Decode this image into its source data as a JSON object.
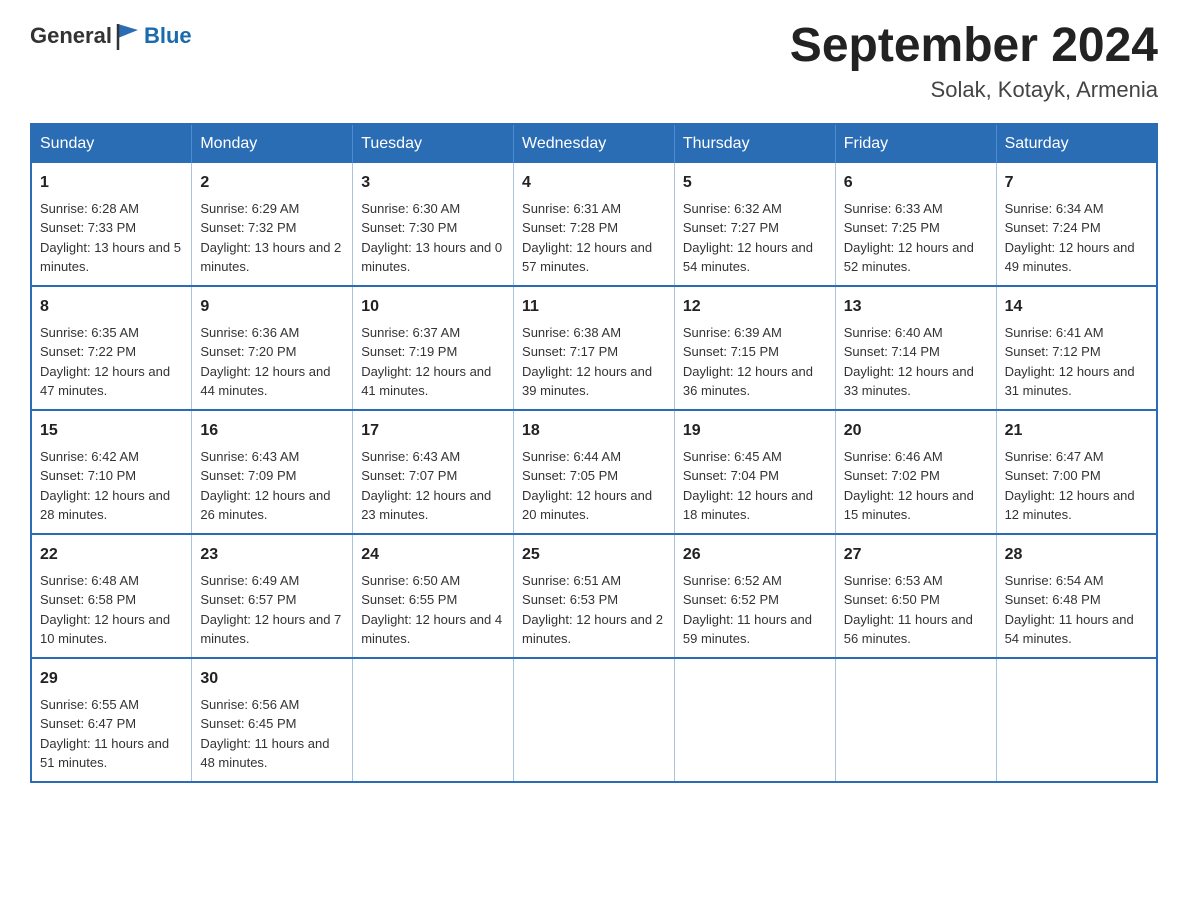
{
  "header": {
    "logo": {
      "text_general": "General",
      "text_blue": "Blue"
    },
    "title": "September 2024",
    "location": "Solak, Kotayk, Armenia"
  },
  "calendar": {
    "days_of_week": [
      "Sunday",
      "Monday",
      "Tuesday",
      "Wednesday",
      "Thursday",
      "Friday",
      "Saturday"
    ],
    "weeks": [
      [
        {
          "day": "1",
          "sunrise": "6:28 AM",
          "sunset": "7:33 PM",
          "daylight": "13 hours and 5 minutes."
        },
        {
          "day": "2",
          "sunrise": "6:29 AM",
          "sunset": "7:32 PM",
          "daylight": "13 hours and 2 minutes."
        },
        {
          "day": "3",
          "sunrise": "6:30 AM",
          "sunset": "7:30 PM",
          "daylight": "13 hours and 0 minutes."
        },
        {
          "day": "4",
          "sunrise": "6:31 AM",
          "sunset": "7:28 PM",
          "daylight": "12 hours and 57 minutes."
        },
        {
          "day": "5",
          "sunrise": "6:32 AM",
          "sunset": "7:27 PM",
          "daylight": "12 hours and 54 minutes."
        },
        {
          "day": "6",
          "sunrise": "6:33 AM",
          "sunset": "7:25 PM",
          "daylight": "12 hours and 52 minutes."
        },
        {
          "day": "7",
          "sunrise": "6:34 AM",
          "sunset": "7:24 PM",
          "daylight": "12 hours and 49 minutes."
        }
      ],
      [
        {
          "day": "8",
          "sunrise": "6:35 AM",
          "sunset": "7:22 PM",
          "daylight": "12 hours and 47 minutes."
        },
        {
          "day": "9",
          "sunrise": "6:36 AM",
          "sunset": "7:20 PM",
          "daylight": "12 hours and 44 minutes."
        },
        {
          "day": "10",
          "sunrise": "6:37 AM",
          "sunset": "7:19 PM",
          "daylight": "12 hours and 41 minutes."
        },
        {
          "day": "11",
          "sunrise": "6:38 AM",
          "sunset": "7:17 PM",
          "daylight": "12 hours and 39 minutes."
        },
        {
          "day": "12",
          "sunrise": "6:39 AM",
          "sunset": "7:15 PM",
          "daylight": "12 hours and 36 minutes."
        },
        {
          "day": "13",
          "sunrise": "6:40 AM",
          "sunset": "7:14 PM",
          "daylight": "12 hours and 33 minutes."
        },
        {
          "day": "14",
          "sunrise": "6:41 AM",
          "sunset": "7:12 PM",
          "daylight": "12 hours and 31 minutes."
        }
      ],
      [
        {
          "day": "15",
          "sunrise": "6:42 AM",
          "sunset": "7:10 PM",
          "daylight": "12 hours and 28 minutes."
        },
        {
          "day": "16",
          "sunrise": "6:43 AM",
          "sunset": "7:09 PM",
          "daylight": "12 hours and 26 minutes."
        },
        {
          "day": "17",
          "sunrise": "6:43 AM",
          "sunset": "7:07 PM",
          "daylight": "12 hours and 23 minutes."
        },
        {
          "day": "18",
          "sunrise": "6:44 AM",
          "sunset": "7:05 PM",
          "daylight": "12 hours and 20 minutes."
        },
        {
          "day": "19",
          "sunrise": "6:45 AM",
          "sunset": "7:04 PM",
          "daylight": "12 hours and 18 minutes."
        },
        {
          "day": "20",
          "sunrise": "6:46 AM",
          "sunset": "7:02 PM",
          "daylight": "12 hours and 15 minutes."
        },
        {
          "day": "21",
          "sunrise": "6:47 AM",
          "sunset": "7:00 PM",
          "daylight": "12 hours and 12 minutes."
        }
      ],
      [
        {
          "day": "22",
          "sunrise": "6:48 AM",
          "sunset": "6:58 PM",
          "daylight": "12 hours and 10 minutes."
        },
        {
          "day": "23",
          "sunrise": "6:49 AM",
          "sunset": "6:57 PM",
          "daylight": "12 hours and 7 minutes."
        },
        {
          "day": "24",
          "sunrise": "6:50 AM",
          "sunset": "6:55 PM",
          "daylight": "12 hours and 4 minutes."
        },
        {
          "day": "25",
          "sunrise": "6:51 AM",
          "sunset": "6:53 PM",
          "daylight": "12 hours and 2 minutes."
        },
        {
          "day": "26",
          "sunrise": "6:52 AM",
          "sunset": "6:52 PM",
          "daylight": "11 hours and 59 minutes."
        },
        {
          "day": "27",
          "sunrise": "6:53 AM",
          "sunset": "6:50 PM",
          "daylight": "11 hours and 56 minutes."
        },
        {
          "day": "28",
          "sunrise": "6:54 AM",
          "sunset": "6:48 PM",
          "daylight": "11 hours and 54 minutes."
        }
      ],
      [
        {
          "day": "29",
          "sunrise": "6:55 AM",
          "sunset": "6:47 PM",
          "daylight": "11 hours and 51 minutes."
        },
        {
          "day": "30",
          "sunrise": "6:56 AM",
          "sunset": "6:45 PM",
          "daylight": "11 hours and 48 minutes."
        },
        null,
        null,
        null,
        null,
        null
      ]
    ]
  }
}
